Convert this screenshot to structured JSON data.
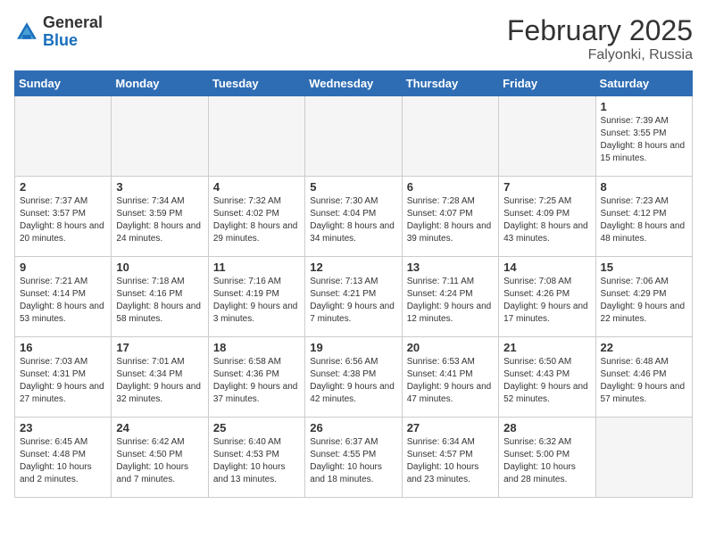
{
  "header": {
    "logo_general": "General",
    "logo_blue": "Blue",
    "month_year": "February 2025",
    "location": "Falyonki, Russia"
  },
  "weekdays": [
    "Sunday",
    "Monday",
    "Tuesday",
    "Wednesday",
    "Thursday",
    "Friday",
    "Saturday"
  ],
  "weeks": [
    [
      {
        "day": "",
        "info": ""
      },
      {
        "day": "",
        "info": ""
      },
      {
        "day": "",
        "info": ""
      },
      {
        "day": "",
        "info": ""
      },
      {
        "day": "",
        "info": ""
      },
      {
        "day": "",
        "info": ""
      },
      {
        "day": "1",
        "info": "Sunrise: 7:39 AM\nSunset: 3:55 PM\nDaylight: 8 hours and 15 minutes."
      }
    ],
    [
      {
        "day": "2",
        "info": "Sunrise: 7:37 AM\nSunset: 3:57 PM\nDaylight: 8 hours and 20 minutes."
      },
      {
        "day": "3",
        "info": "Sunrise: 7:34 AM\nSunset: 3:59 PM\nDaylight: 8 hours and 24 minutes."
      },
      {
        "day": "4",
        "info": "Sunrise: 7:32 AM\nSunset: 4:02 PM\nDaylight: 8 hours and 29 minutes."
      },
      {
        "day": "5",
        "info": "Sunrise: 7:30 AM\nSunset: 4:04 PM\nDaylight: 8 hours and 34 minutes."
      },
      {
        "day": "6",
        "info": "Sunrise: 7:28 AM\nSunset: 4:07 PM\nDaylight: 8 hours and 39 minutes."
      },
      {
        "day": "7",
        "info": "Sunrise: 7:25 AM\nSunset: 4:09 PM\nDaylight: 8 hours and 43 minutes."
      },
      {
        "day": "8",
        "info": "Sunrise: 7:23 AM\nSunset: 4:12 PM\nDaylight: 8 hours and 48 minutes."
      }
    ],
    [
      {
        "day": "9",
        "info": "Sunrise: 7:21 AM\nSunset: 4:14 PM\nDaylight: 8 hours and 53 minutes."
      },
      {
        "day": "10",
        "info": "Sunrise: 7:18 AM\nSunset: 4:16 PM\nDaylight: 8 hours and 58 minutes."
      },
      {
        "day": "11",
        "info": "Sunrise: 7:16 AM\nSunset: 4:19 PM\nDaylight: 9 hours and 3 minutes."
      },
      {
        "day": "12",
        "info": "Sunrise: 7:13 AM\nSunset: 4:21 PM\nDaylight: 9 hours and 7 minutes."
      },
      {
        "day": "13",
        "info": "Sunrise: 7:11 AM\nSunset: 4:24 PM\nDaylight: 9 hours and 12 minutes."
      },
      {
        "day": "14",
        "info": "Sunrise: 7:08 AM\nSunset: 4:26 PM\nDaylight: 9 hours and 17 minutes."
      },
      {
        "day": "15",
        "info": "Sunrise: 7:06 AM\nSunset: 4:29 PM\nDaylight: 9 hours and 22 minutes."
      }
    ],
    [
      {
        "day": "16",
        "info": "Sunrise: 7:03 AM\nSunset: 4:31 PM\nDaylight: 9 hours and 27 minutes."
      },
      {
        "day": "17",
        "info": "Sunrise: 7:01 AM\nSunset: 4:34 PM\nDaylight: 9 hours and 32 minutes."
      },
      {
        "day": "18",
        "info": "Sunrise: 6:58 AM\nSunset: 4:36 PM\nDaylight: 9 hours and 37 minutes."
      },
      {
        "day": "19",
        "info": "Sunrise: 6:56 AM\nSunset: 4:38 PM\nDaylight: 9 hours and 42 minutes."
      },
      {
        "day": "20",
        "info": "Sunrise: 6:53 AM\nSunset: 4:41 PM\nDaylight: 9 hours and 47 minutes."
      },
      {
        "day": "21",
        "info": "Sunrise: 6:50 AM\nSunset: 4:43 PM\nDaylight: 9 hours and 52 minutes."
      },
      {
        "day": "22",
        "info": "Sunrise: 6:48 AM\nSunset: 4:46 PM\nDaylight: 9 hours and 57 minutes."
      }
    ],
    [
      {
        "day": "23",
        "info": "Sunrise: 6:45 AM\nSunset: 4:48 PM\nDaylight: 10 hours and 2 minutes."
      },
      {
        "day": "24",
        "info": "Sunrise: 6:42 AM\nSunset: 4:50 PM\nDaylight: 10 hours and 7 minutes."
      },
      {
        "day": "25",
        "info": "Sunrise: 6:40 AM\nSunset: 4:53 PM\nDaylight: 10 hours and 13 minutes."
      },
      {
        "day": "26",
        "info": "Sunrise: 6:37 AM\nSunset: 4:55 PM\nDaylight: 10 hours and 18 minutes."
      },
      {
        "day": "27",
        "info": "Sunrise: 6:34 AM\nSunset: 4:57 PM\nDaylight: 10 hours and 23 minutes."
      },
      {
        "day": "28",
        "info": "Sunrise: 6:32 AM\nSunset: 5:00 PM\nDaylight: 10 hours and 28 minutes."
      },
      {
        "day": "",
        "info": ""
      }
    ]
  ]
}
